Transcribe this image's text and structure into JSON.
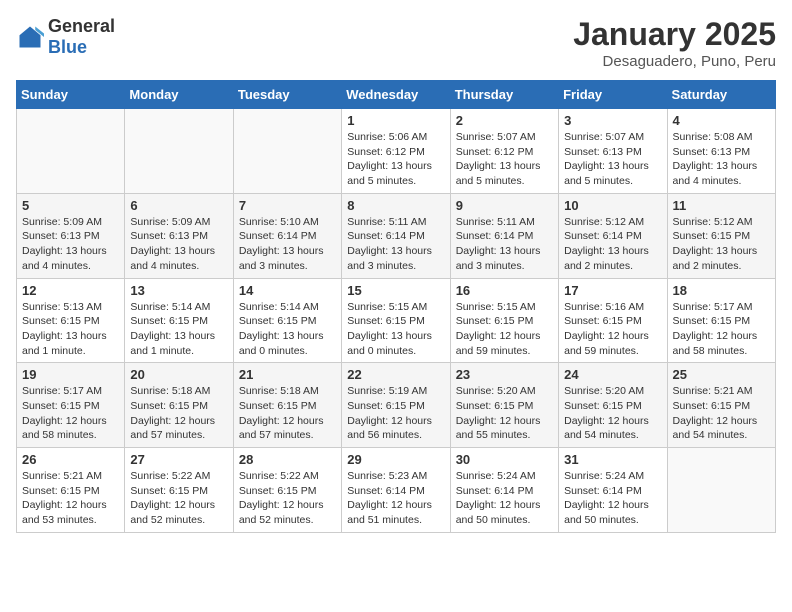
{
  "header": {
    "logo_general": "General",
    "logo_blue": "Blue",
    "title": "January 2025",
    "subtitle": "Desaguadero, Puno, Peru"
  },
  "weekdays": [
    "Sunday",
    "Monday",
    "Tuesday",
    "Wednesday",
    "Thursday",
    "Friday",
    "Saturday"
  ],
  "weeks": [
    [
      {
        "day": "",
        "info": ""
      },
      {
        "day": "",
        "info": ""
      },
      {
        "day": "",
        "info": ""
      },
      {
        "day": "1",
        "info": "Sunrise: 5:06 AM\nSunset: 6:12 PM\nDaylight: 13 hours\nand 5 minutes."
      },
      {
        "day": "2",
        "info": "Sunrise: 5:07 AM\nSunset: 6:12 PM\nDaylight: 13 hours\nand 5 minutes."
      },
      {
        "day": "3",
        "info": "Sunrise: 5:07 AM\nSunset: 6:13 PM\nDaylight: 13 hours\nand 5 minutes."
      },
      {
        "day": "4",
        "info": "Sunrise: 5:08 AM\nSunset: 6:13 PM\nDaylight: 13 hours\nand 4 minutes."
      }
    ],
    [
      {
        "day": "5",
        "info": "Sunrise: 5:09 AM\nSunset: 6:13 PM\nDaylight: 13 hours\nand 4 minutes."
      },
      {
        "day": "6",
        "info": "Sunrise: 5:09 AM\nSunset: 6:13 PM\nDaylight: 13 hours\nand 4 minutes."
      },
      {
        "day": "7",
        "info": "Sunrise: 5:10 AM\nSunset: 6:14 PM\nDaylight: 13 hours\nand 3 minutes."
      },
      {
        "day": "8",
        "info": "Sunrise: 5:11 AM\nSunset: 6:14 PM\nDaylight: 13 hours\nand 3 minutes."
      },
      {
        "day": "9",
        "info": "Sunrise: 5:11 AM\nSunset: 6:14 PM\nDaylight: 13 hours\nand 3 minutes."
      },
      {
        "day": "10",
        "info": "Sunrise: 5:12 AM\nSunset: 6:14 PM\nDaylight: 13 hours\nand 2 minutes."
      },
      {
        "day": "11",
        "info": "Sunrise: 5:12 AM\nSunset: 6:15 PM\nDaylight: 13 hours\nand 2 minutes."
      }
    ],
    [
      {
        "day": "12",
        "info": "Sunrise: 5:13 AM\nSunset: 6:15 PM\nDaylight: 13 hours\nand 1 minute."
      },
      {
        "day": "13",
        "info": "Sunrise: 5:14 AM\nSunset: 6:15 PM\nDaylight: 13 hours\nand 1 minute."
      },
      {
        "day": "14",
        "info": "Sunrise: 5:14 AM\nSunset: 6:15 PM\nDaylight: 13 hours\nand 0 minutes."
      },
      {
        "day": "15",
        "info": "Sunrise: 5:15 AM\nSunset: 6:15 PM\nDaylight: 13 hours\nand 0 minutes."
      },
      {
        "day": "16",
        "info": "Sunrise: 5:15 AM\nSunset: 6:15 PM\nDaylight: 12 hours\nand 59 minutes."
      },
      {
        "day": "17",
        "info": "Sunrise: 5:16 AM\nSunset: 6:15 PM\nDaylight: 12 hours\nand 59 minutes."
      },
      {
        "day": "18",
        "info": "Sunrise: 5:17 AM\nSunset: 6:15 PM\nDaylight: 12 hours\nand 58 minutes."
      }
    ],
    [
      {
        "day": "19",
        "info": "Sunrise: 5:17 AM\nSunset: 6:15 PM\nDaylight: 12 hours\nand 58 minutes."
      },
      {
        "day": "20",
        "info": "Sunrise: 5:18 AM\nSunset: 6:15 PM\nDaylight: 12 hours\nand 57 minutes."
      },
      {
        "day": "21",
        "info": "Sunrise: 5:18 AM\nSunset: 6:15 PM\nDaylight: 12 hours\nand 57 minutes."
      },
      {
        "day": "22",
        "info": "Sunrise: 5:19 AM\nSunset: 6:15 PM\nDaylight: 12 hours\nand 56 minutes."
      },
      {
        "day": "23",
        "info": "Sunrise: 5:20 AM\nSunset: 6:15 PM\nDaylight: 12 hours\nand 55 minutes."
      },
      {
        "day": "24",
        "info": "Sunrise: 5:20 AM\nSunset: 6:15 PM\nDaylight: 12 hours\nand 54 minutes."
      },
      {
        "day": "25",
        "info": "Sunrise: 5:21 AM\nSunset: 6:15 PM\nDaylight: 12 hours\nand 54 minutes."
      }
    ],
    [
      {
        "day": "26",
        "info": "Sunrise: 5:21 AM\nSunset: 6:15 PM\nDaylight: 12 hours\nand 53 minutes."
      },
      {
        "day": "27",
        "info": "Sunrise: 5:22 AM\nSunset: 6:15 PM\nDaylight: 12 hours\nand 52 minutes."
      },
      {
        "day": "28",
        "info": "Sunrise: 5:22 AM\nSunset: 6:15 PM\nDaylight: 12 hours\nand 52 minutes."
      },
      {
        "day": "29",
        "info": "Sunrise: 5:23 AM\nSunset: 6:14 PM\nDaylight: 12 hours\nand 51 minutes."
      },
      {
        "day": "30",
        "info": "Sunrise: 5:24 AM\nSunset: 6:14 PM\nDaylight: 12 hours\nand 50 minutes."
      },
      {
        "day": "31",
        "info": "Sunrise: 5:24 AM\nSunset: 6:14 PM\nDaylight: 12 hours\nand 50 minutes."
      },
      {
        "day": "",
        "info": ""
      }
    ]
  ]
}
